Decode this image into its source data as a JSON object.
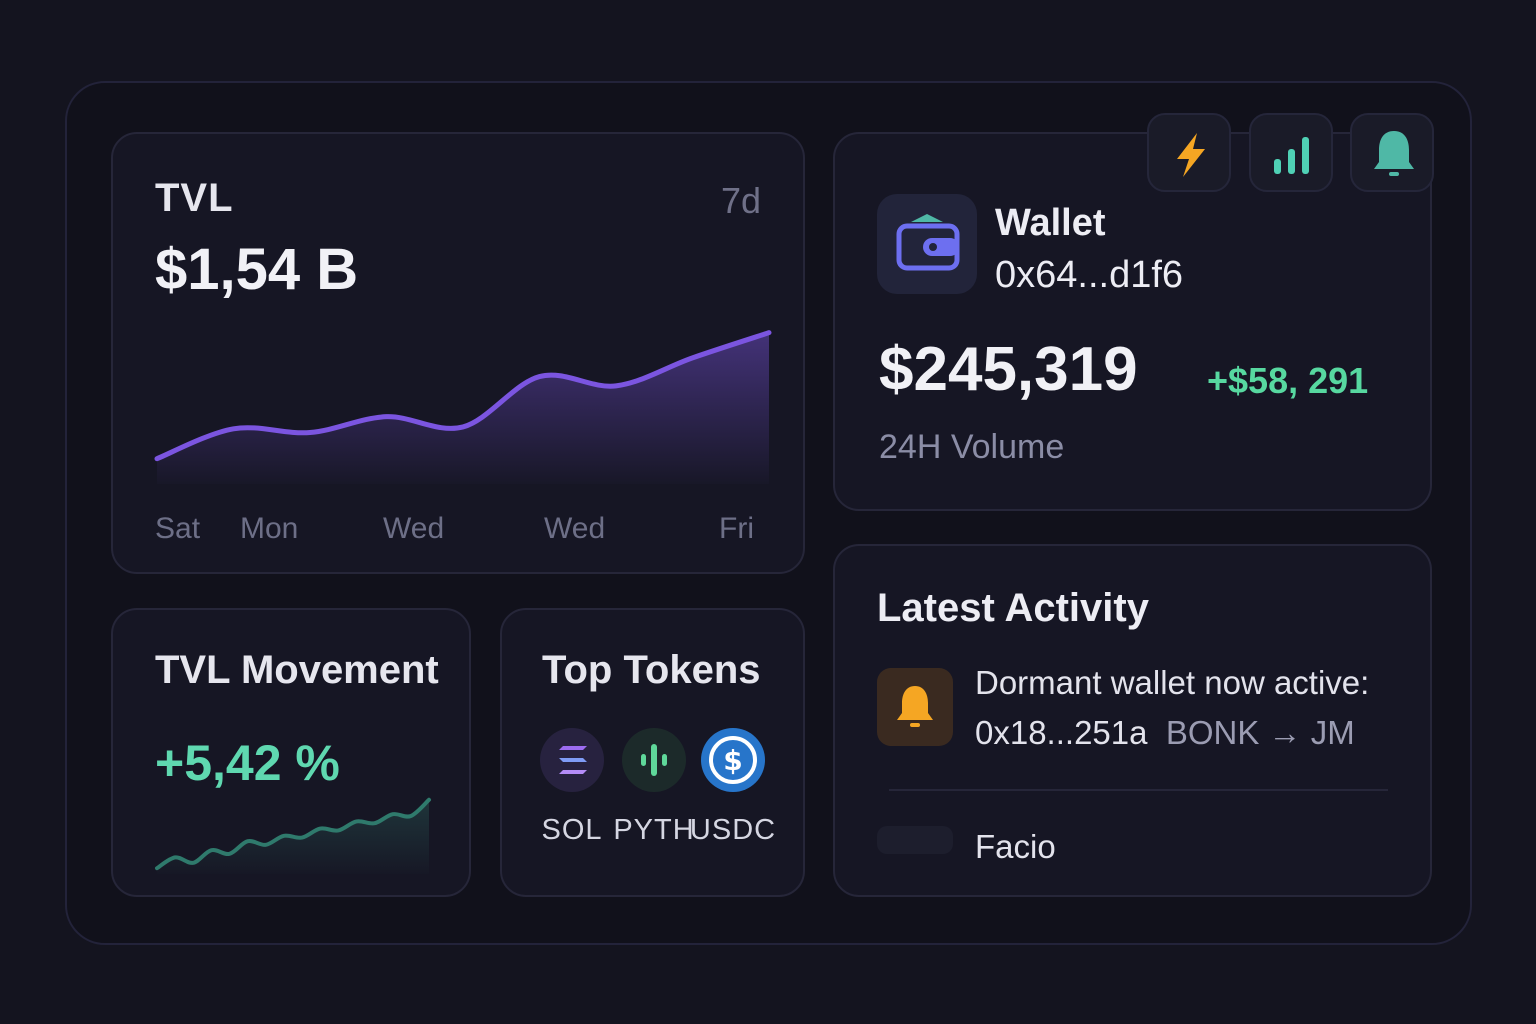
{
  "tvl": {
    "title": "TVL",
    "period": "7d",
    "value": "$1,54 B",
    "x_labels": [
      "Sat",
      "Mon",
      "Wed",
      "Wed",
      "Fri"
    ]
  },
  "wallet": {
    "name": "Wallet",
    "address": "0x64...d1f6",
    "balance": "$245,319",
    "change": "+$58, 291",
    "volume_label": "24H Volume"
  },
  "actions": [
    {
      "icon": "lightning-icon",
      "color": "#f5a623"
    },
    {
      "icon": "bar-chart-icon",
      "color": "#4fd1b5"
    },
    {
      "icon": "bell-icon",
      "color": "#4fb8a6"
    }
  ],
  "movement": {
    "title": "TVL Movement",
    "value": "+5,42 %"
  },
  "tokens": {
    "title": "Top Tokens",
    "items": [
      {
        "symbol": "SOL",
        "icon": "sol-logo-icon",
        "color": "#2a2547"
      },
      {
        "symbol": "PYTH",
        "icon": "pyth-logo-icon",
        "color": "#1c2a2a"
      },
      {
        "symbol": "USDC",
        "icon": "usdc-logo-icon",
        "color": "#2775ca"
      }
    ]
  },
  "activity": {
    "title": "Latest Activity",
    "items": [
      {
        "line1": "Dormant wallet now active:",
        "address": "0x18...251a",
        "from": "BONK",
        "arrow": "→",
        "to": "JM",
        "icon": "bell-icon"
      },
      {
        "label": "Facio"
      }
    ]
  },
  "chart_data": [
    {
      "type": "area",
      "title": "TVL",
      "categories": [
        "Sat",
        "Mon",
        "Wed",
        "Wed",
        "Fri"
      ],
      "series": [
        {
          "values": [
            0.1,
            0.42,
            0.38,
            0.55,
            0.44,
            0.98,
            0.88,
            1.18,
            1.45
          ]
        }
      ],
      "color": "#7b55e0"
    },
    {
      "type": "area",
      "title": "TVL Movement",
      "series": [
        {
          "values": [
            0.05,
            0.35,
            0.2,
            0.55,
            0.45,
            0.8,
            0.7,
            0.95,
            0.9,
            1.15,
            1.1,
            1.35,
            1.3,
            1.55,
            1.5,
            1.95
          ]
        }
      ],
      "color": "#2f6f64"
    }
  ]
}
